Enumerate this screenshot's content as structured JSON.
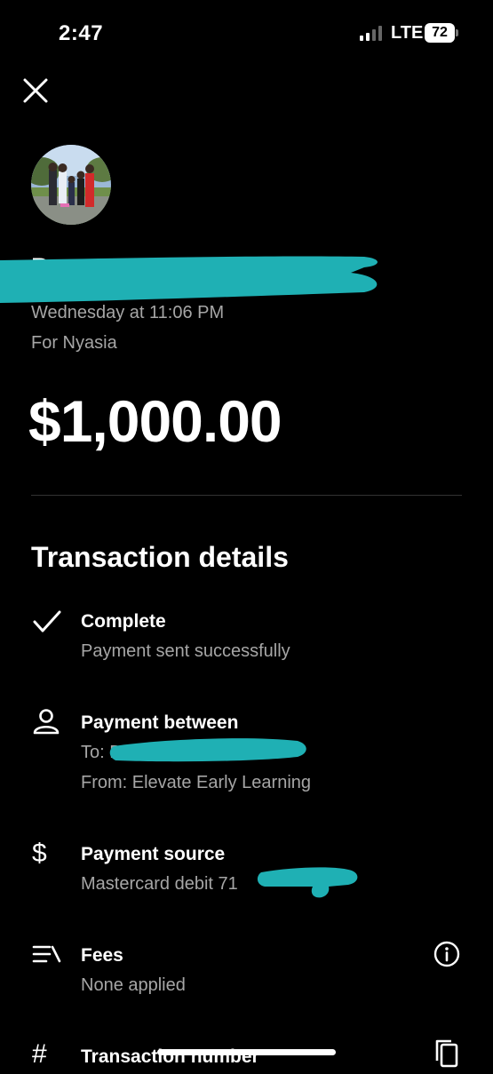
{
  "status_bar": {
    "time": "2:47",
    "network": "LTE",
    "battery": "72"
  },
  "header": {
    "close_icon": "close-icon"
  },
  "payment": {
    "name": "Da",
    "date": "Wednesday at 11:06 PM",
    "memo": "For Nyasia",
    "amount": "$1,000.00"
  },
  "details": {
    "title": "Transaction details",
    "status": {
      "icon": "checkmark-icon",
      "title": "Complete",
      "subtitle": "Payment sent successfully"
    },
    "between": {
      "icon": "person-icon",
      "title": "Payment between",
      "to": "To: D",
      "from": "From: Elevate Early Learning"
    },
    "source": {
      "icon": "dollar-icon",
      "title": "Payment source",
      "subtitle": "Mastercard debit 71"
    },
    "fees": {
      "icon": "fees-icon",
      "title": "Fees",
      "subtitle": "None applied",
      "info_icon": "info-icon"
    },
    "transaction_number": {
      "icon": "hash-icon",
      "title": "Transaction number",
      "copy_icon": "copy-icon"
    }
  },
  "colors": {
    "background": "#000000",
    "text": "#ffffff",
    "secondary_text": "#a6a6a6",
    "redaction": "#1fb0b4"
  }
}
